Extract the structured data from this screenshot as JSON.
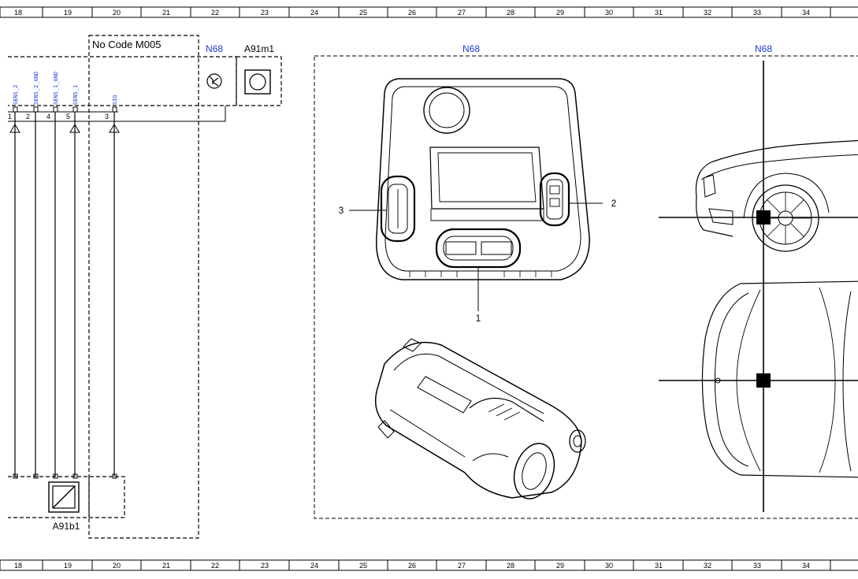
{
  "ruler": {
    "columns": [
      "18",
      "19",
      "20",
      "21",
      "22",
      "23",
      "24",
      "25",
      "26",
      "27",
      "28",
      "29",
      "30",
      "31",
      "32",
      "33",
      "34"
    ]
  },
  "components": {
    "no_code_box": "No Code M005",
    "n68_left": "N68",
    "a91m1": "A91m1",
    "n68_center": "N68",
    "n68_right": "N68",
    "a91b1": "A91b1"
  },
  "pins": [
    {
      "num": "1",
      "signal": "SENS_2"
    },
    {
      "num": "2",
      "signal": "SENS_2_GND"
    },
    {
      "num": "4",
      "signal": "SENS_1_GND"
    },
    {
      "num": "5",
      "signal": "SENS_1"
    },
    {
      "num": "3",
      "signal": "SIG"
    }
  ],
  "callouts": [
    "1",
    "2",
    "3"
  ],
  "colors": {
    "line": "#000000",
    "label_blue": "#1a3fd6",
    "background": "#ffffff"
  }
}
